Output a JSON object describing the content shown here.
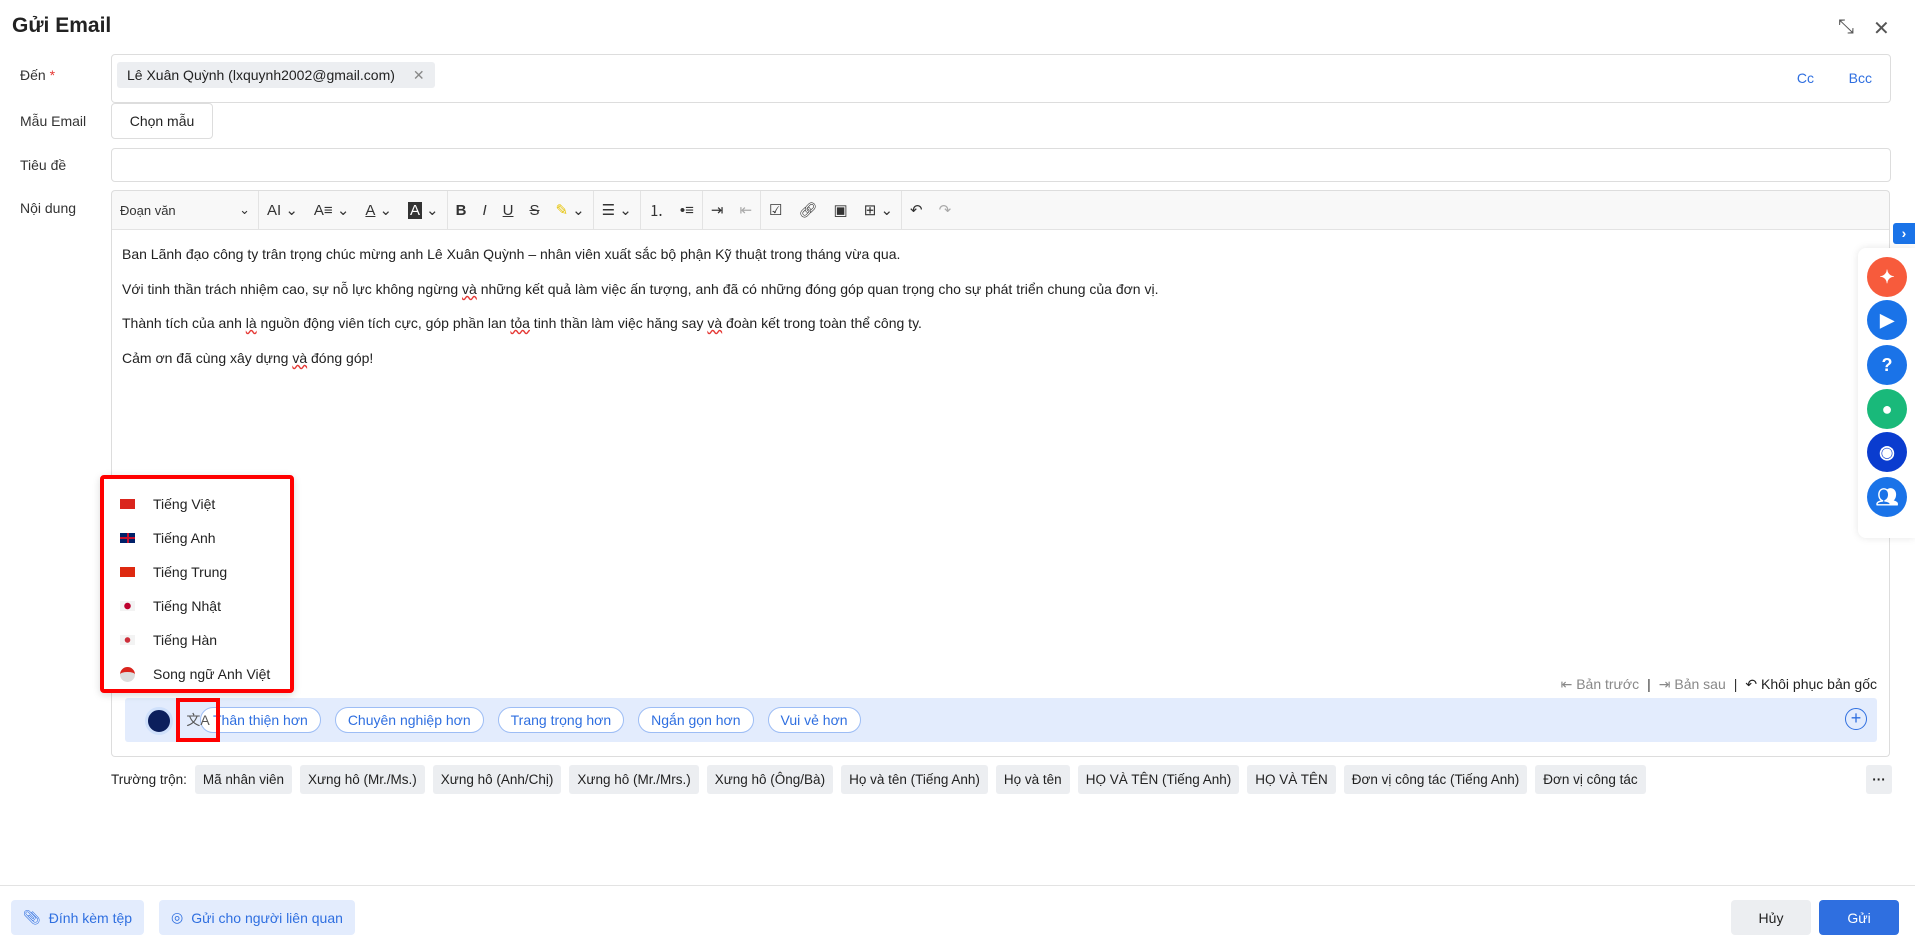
{
  "header": {
    "title": "Gửi Email"
  },
  "form": {
    "to_label": "Đến",
    "required_mark": "*",
    "recipient": "Lê Xuân Quỳnh (lxquynh2002@gmail.com)",
    "cc": "Cc",
    "bcc": "Bcc",
    "template_label": "Mẫu Email",
    "template_button": "Chọn mẫu",
    "subject_label": "Tiêu đề",
    "subject_value": "",
    "content_label": "Nội dung"
  },
  "toolbar": {
    "paragraph_style": "Đoạn văn"
  },
  "content": {
    "p1": "Ban Lãnh đạo công ty trân trọng chúc mừng anh Lê Xuân Quỳnh – nhân viên xuất sắc bộ phận Kỹ thuật trong tháng vừa qua.",
    "p2a": "Với tinh thần trách nhiệm cao, sự nỗ lực không ngừng ",
    "p2b": "và",
    "p2c": " những kết quả làm việc ấn tượng, anh đã có những đóng góp quan trọng cho sự phát triển chung của đơn vị.",
    "p3a": "Thành tích của anh ",
    "p3b": "là",
    "p3c": " nguồn động viên tích cực, góp phần lan ",
    "p3d": "tỏa",
    "p3e": " tinh thần làm việc hăng say ",
    "p3f": "và",
    "p3g": " đoàn kết trong toàn thể công ty.",
    "p4a": "Cảm ơn đã cùng xây dựng ",
    "p4b": "và",
    "p4c": " đóng góp!"
  },
  "language_menu": [
    {
      "label": "Tiếng Việt",
      "flag": "vn"
    },
    {
      "label": "Tiếng Anh",
      "flag": "gb"
    },
    {
      "label": "Tiếng Trung",
      "flag": "cn"
    },
    {
      "label": "Tiếng Nhật",
      "flag": "jp"
    },
    {
      "label": "Tiếng Hàn",
      "flag": "kr"
    },
    {
      "label": "Song ngữ Anh Việt",
      "flag": "bilingual"
    }
  ],
  "history": {
    "prev": "Bản trước",
    "next": "Bản sau",
    "restore": "Khôi phục bản gốc"
  },
  "ai_tones": [
    "Thân thiện hơn",
    "Chuyên nghiệp hơn",
    "Trang trọng hơn",
    "Ngắn gọn hơn",
    "Vui vẻ hơn"
  ],
  "merge": {
    "label": "Trường trộn:",
    "fields": [
      "Mã nhân viên",
      "Xưng hô (Mr./Ms.)",
      "Xưng hô (Anh/Chị)",
      "Xưng hô (Mr./Mrs.)",
      "Xưng hô (Ông/Bà)",
      "Họ và tên (Tiếng Anh)",
      "Họ và tên",
      "HỌ VÀ TÊN (Tiếng Anh)",
      "HỌ VÀ TÊN",
      "Đơn vị công tác (Tiếng Anh)",
      "Đơn vị công tác"
    ]
  },
  "footer": {
    "attach": "Đính kèm tệp",
    "send_related": "Gửi cho người liên quan",
    "cancel": "Hủy",
    "send": "Gửi"
  },
  "colors": {
    "primary": "#2f6fe0",
    "highlight": "#ff0000"
  }
}
